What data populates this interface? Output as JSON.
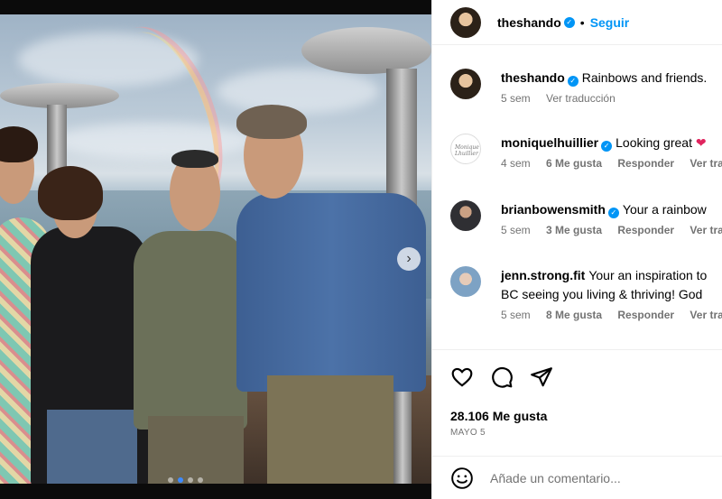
{
  "post": {
    "author": "theshando",
    "follow_label": "Seguir",
    "separator": "•"
  },
  "caption": {
    "username": "theshando",
    "text": "Rainbows and friends.",
    "time": "5 sem",
    "translate": "Ver traducción"
  },
  "comments": [
    {
      "username": "moniquelhuillier",
      "text": "Looking great",
      "emoji": "❤",
      "time": "4 sem",
      "likes": "6 Me gusta",
      "reply": "Responder",
      "translate": "Ver traducción"
    },
    {
      "username": "brianbowensmith",
      "text": "Your a rainbow",
      "time": "5 sem",
      "likes": "3 Me gusta",
      "reply": "Responder",
      "translate": "Ver traducción"
    },
    {
      "username": "jenn.strong.fit",
      "text": "Your an inspiration to",
      "text_line2": "BC seeing you living & thriving! God",
      "time": "5 sem",
      "likes": "8 Me gusta",
      "reply": "Responder",
      "translate": "Ver traducción"
    }
  ],
  "avatar_text": {
    "monique": "Monique Lhuillier"
  },
  "stats": {
    "likes": "28.106 Me gusta",
    "date": "MAYO 5"
  },
  "composer": {
    "placeholder": "Añade un comentario..."
  },
  "icons": {
    "like": "heart-icon",
    "comment": "comment-icon",
    "share": "send-icon",
    "emoji": "emoji-icon",
    "verified": "verified-icon",
    "next": "chevron-right-icon"
  },
  "carousel": {
    "total": 4,
    "current": 2
  },
  "colors": {
    "accent": "#0095f6",
    "heart": "#e0245e",
    "muted": "#737373"
  }
}
